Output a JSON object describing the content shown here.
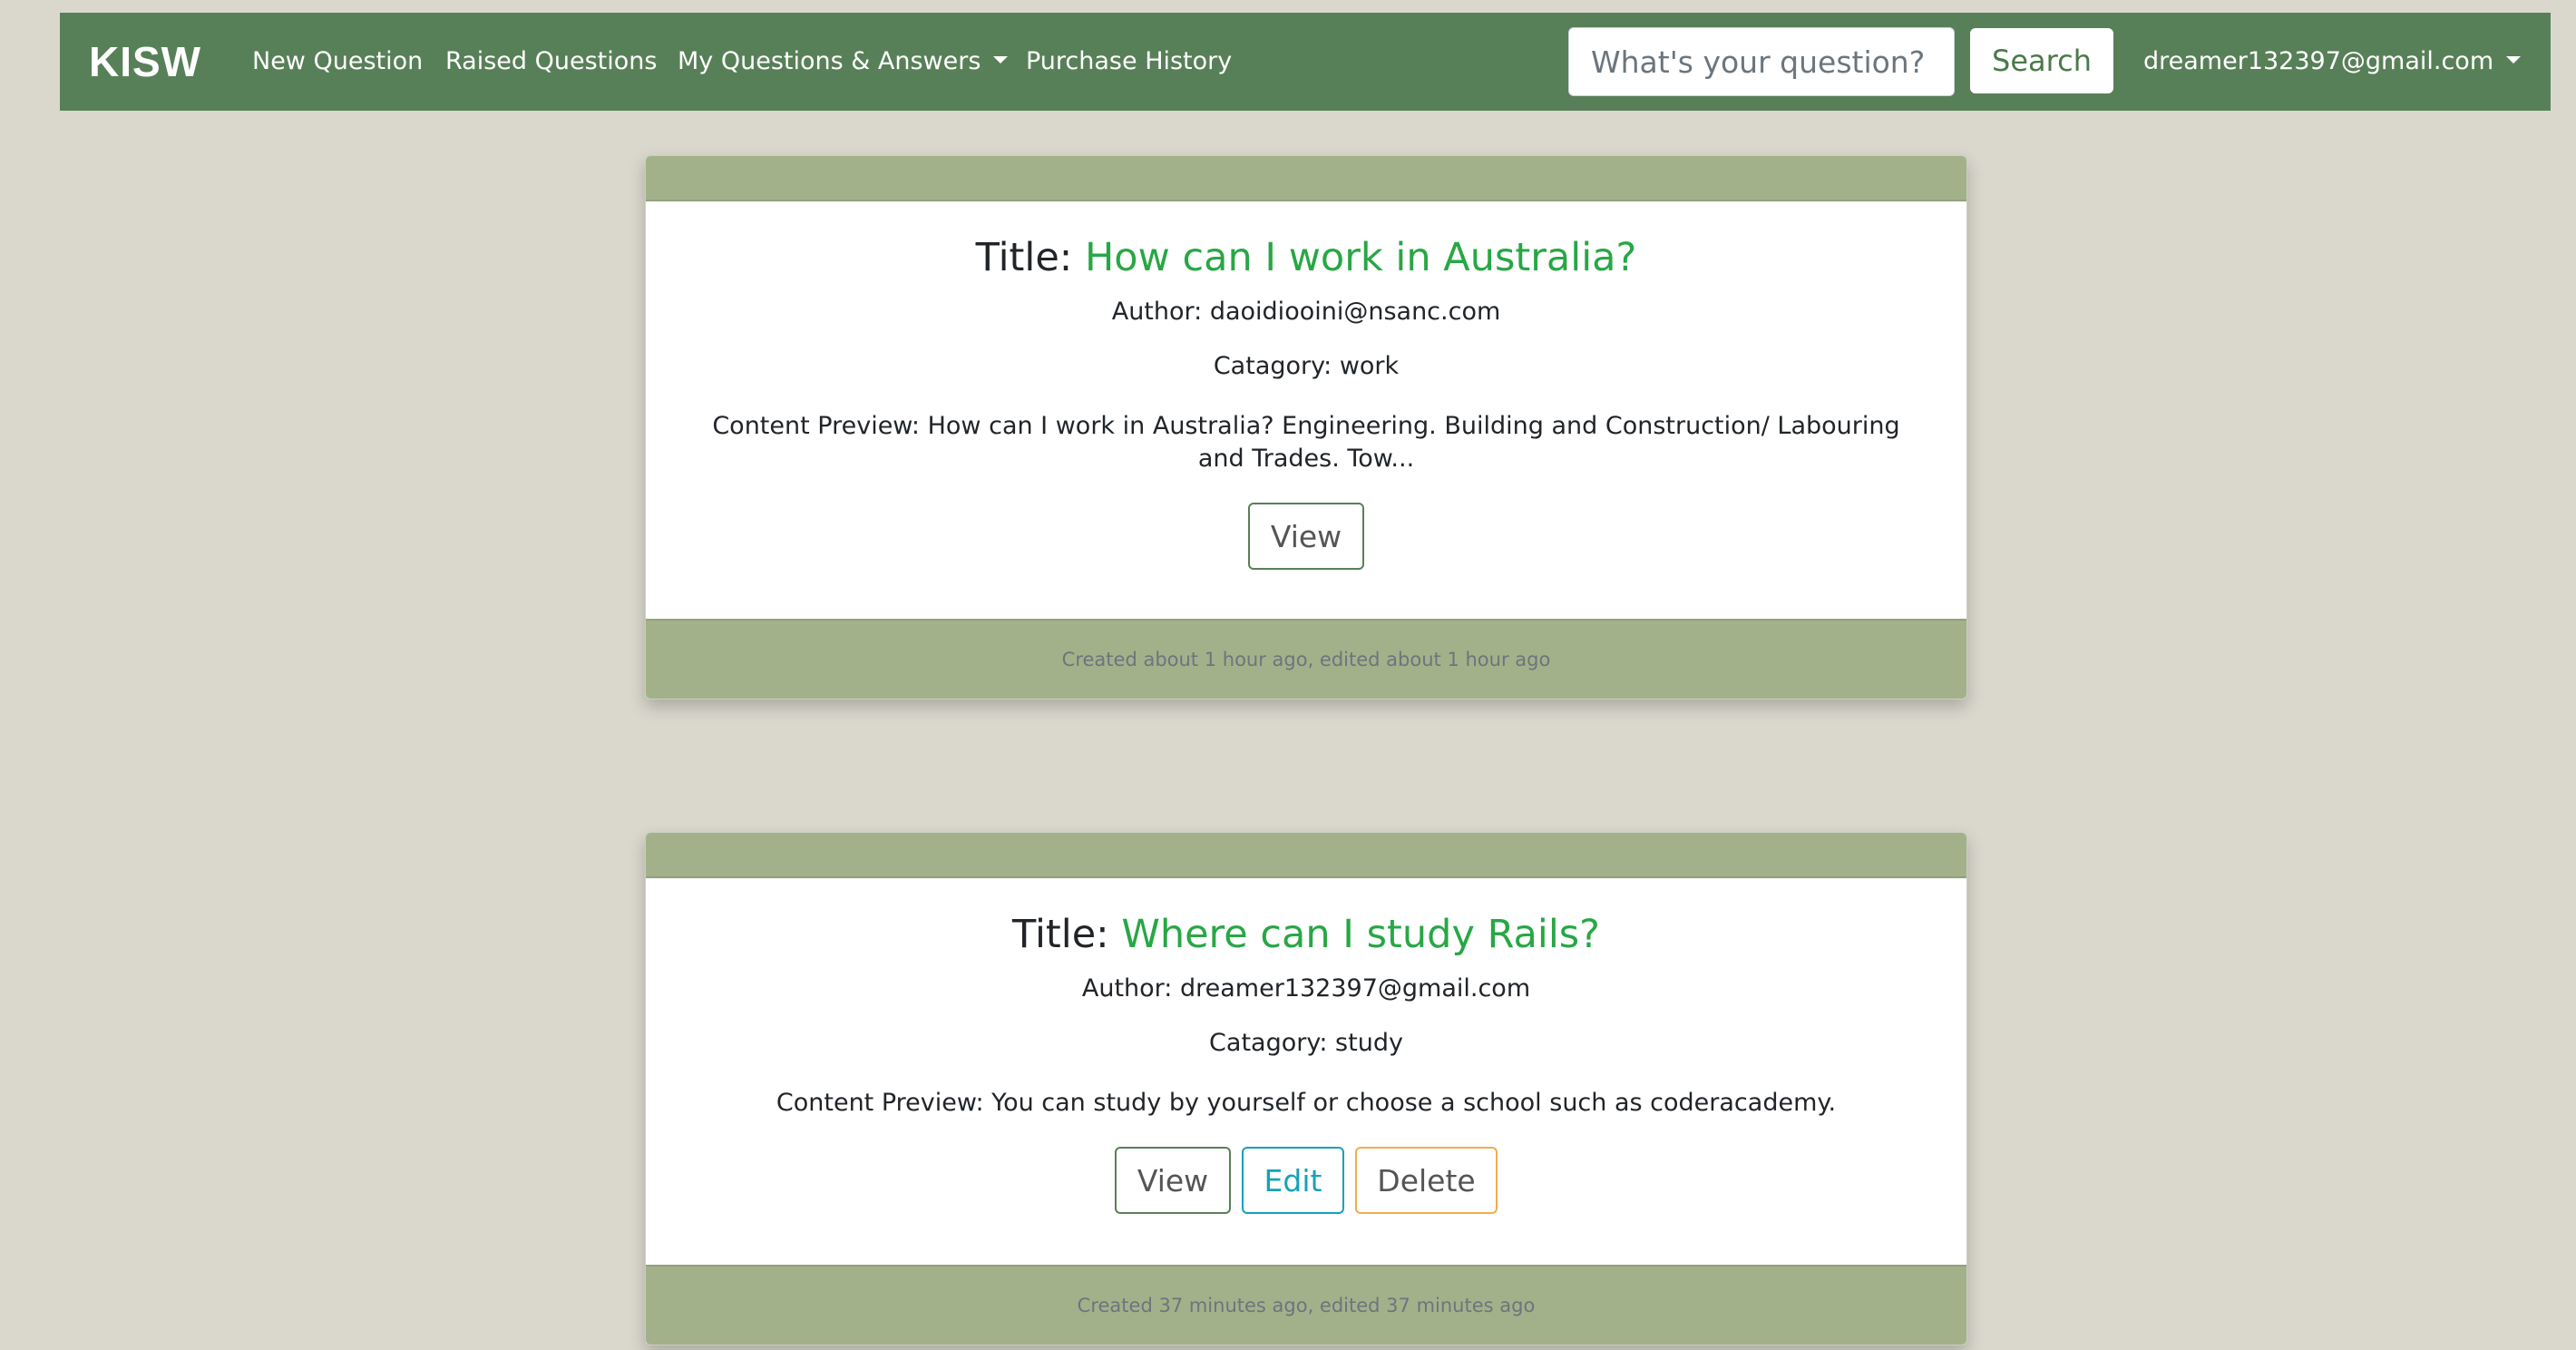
{
  "navbar": {
    "brand": "KISW",
    "links": {
      "new_question": "New Question",
      "raised_questions": "Raised Questions",
      "my_qa": "My Questions & Answers",
      "purchase_history": "Purchase History"
    },
    "search": {
      "placeholder": "What's your question?",
      "value": "",
      "button_label": "Search"
    },
    "user_email": "dreamer132397@gmail.com"
  },
  "questions": [
    {
      "title_prefix": "Title:",
      "title": "How can I work in Australia?",
      "author_label": "Author:",
      "author": "daoidiooini@nsanc.com",
      "category_label": "Catagory:",
      "category": "work",
      "preview_label": "Content Preview:",
      "preview": "How can I work in Australia? Engineering. Building and Construction/ Labouring and Trades. Tow...",
      "buttons": {
        "view": "View"
      },
      "footer": "Created about 1 hour ago, edited about 1 hour ago"
    },
    {
      "title_prefix": "Title:",
      "title": "Where can I study Rails?",
      "author_label": "Author:",
      "author": "dreamer132397@gmail.com",
      "category_label": "Catagory:",
      "category": "study",
      "preview_label": "Content Preview:",
      "preview": "You can study by yourself or choose a school such as coderacademy.",
      "buttons": {
        "view": "View",
        "edit": "Edit",
        "delete": "Delete"
      },
      "footer": "Created 37 minutes ago, edited 37 minutes ago"
    }
  ],
  "colors": {
    "navbar_bg": "#588058",
    "card_header_bg": "#a3b18a",
    "title_link": "#28a745",
    "page_bg": "#dad8cd"
  }
}
